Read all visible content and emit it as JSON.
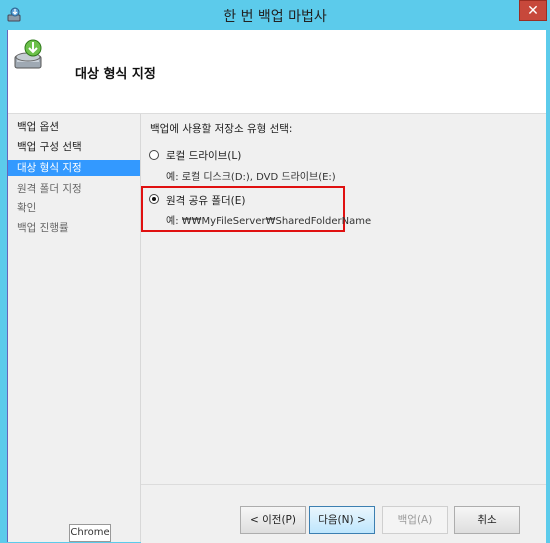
{
  "window": {
    "title": "한 번 백업 마법사",
    "close_label": "✕"
  },
  "header": {
    "title": "대상 형식 지정",
    "icon": "backup-drive-icon"
  },
  "sidebar": {
    "items": [
      {
        "label": "백업 옵션"
      },
      {
        "label": "백업 구성 선택"
      },
      {
        "label": "대상 형식 지정"
      },
      {
        "label": "원격 폴더 지정"
      },
      {
        "label": "확인"
      },
      {
        "label": "백업 진행률"
      }
    ],
    "active_index": 2
  },
  "taskbar_tooltip": "Chrome",
  "main": {
    "instruction": "백업에 사용할 저장소 유형 선택:",
    "options": [
      {
        "label": "로컬 드라이브(L)",
        "example": "예: 로컬 디스크(D:), DVD 드라이브(E:)",
        "selected": false
      },
      {
        "label": "원격 공유 폴더(E)",
        "example": "예: ₩₩MyFileServer₩SharedFolderName",
        "selected": true
      }
    ]
  },
  "footer": {
    "prev_label": "< 이전(P)",
    "next_label": "다음(N) >",
    "backup_label": "백업(A)",
    "cancel_label": "취소"
  },
  "colors": {
    "titlebar": "#5ccbeb",
    "highlight": "#e01010",
    "active_nav": "#3399ff"
  }
}
